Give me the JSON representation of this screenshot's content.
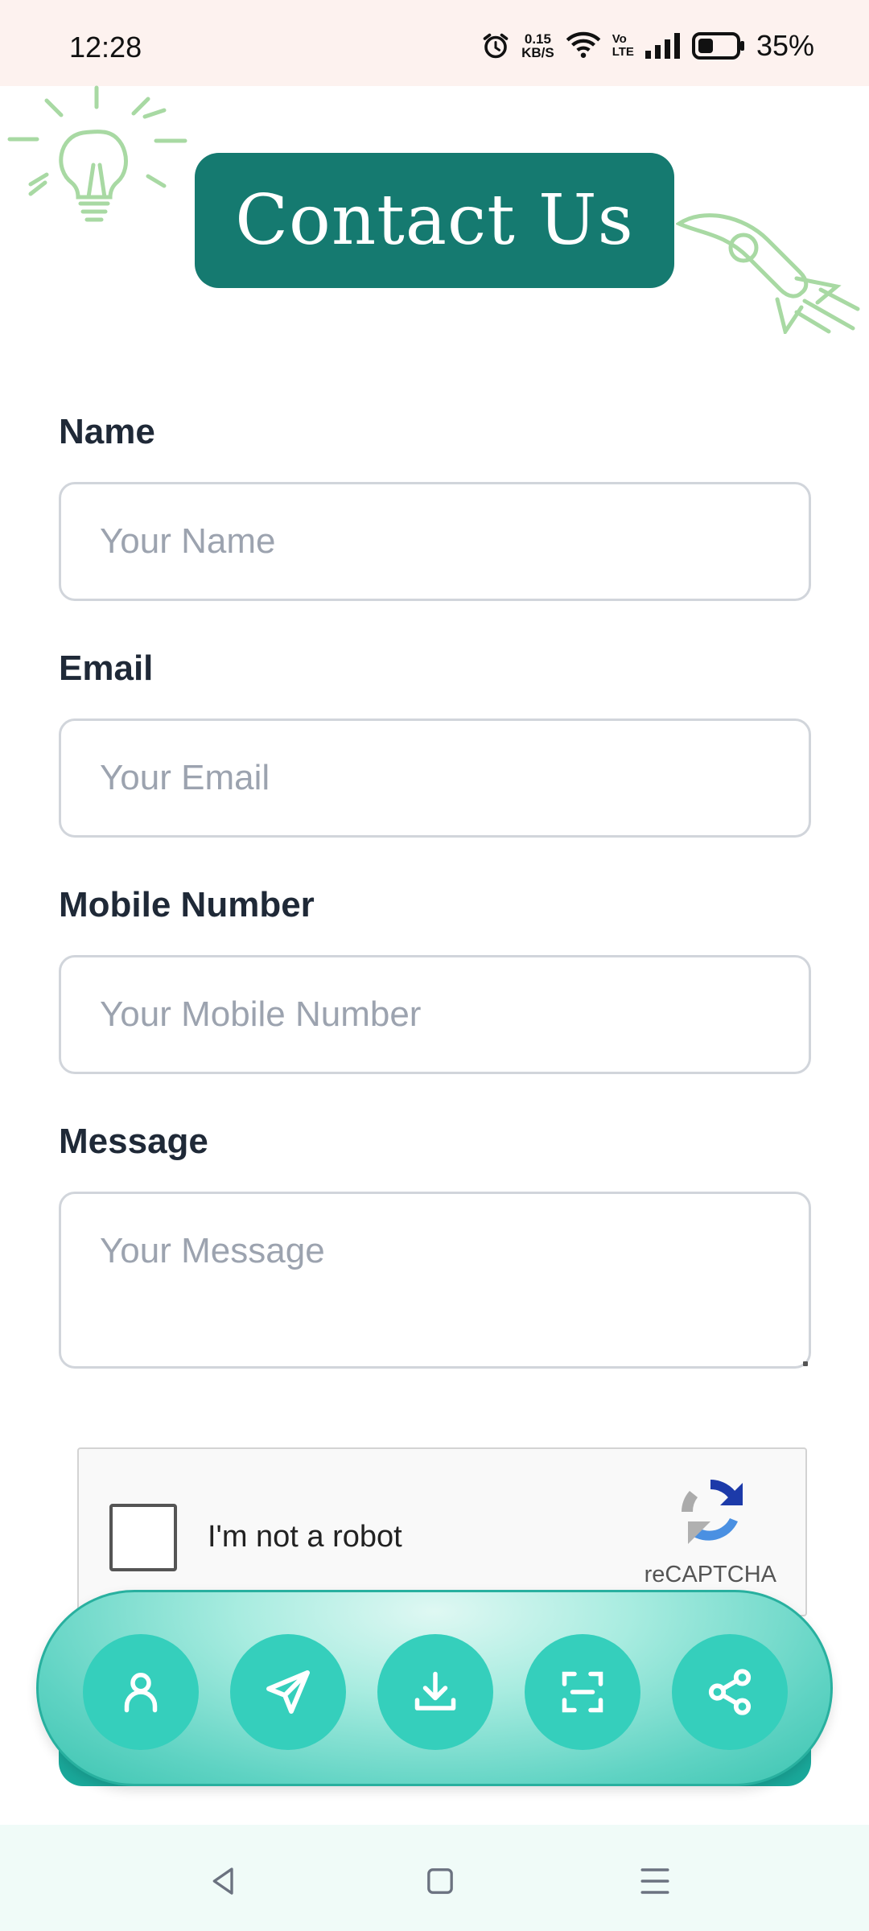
{
  "status_bar": {
    "time": "12:28",
    "net_speed_value": "0.15",
    "net_speed_unit": "KB/S",
    "volte_top": "Vo",
    "volte_bottom": "LTE",
    "battery": "35%"
  },
  "header": {
    "title": "Contact Us"
  },
  "form": {
    "name": {
      "label": "Name",
      "placeholder": "Your Name",
      "value": ""
    },
    "email": {
      "label": "Email",
      "placeholder": "Your Email",
      "value": ""
    },
    "mobile": {
      "label": "Mobile Number",
      "placeholder": "Your Mobile Number",
      "value": ""
    },
    "message": {
      "label": "Message",
      "placeholder": "Your Message",
      "value": ""
    }
  },
  "recaptcha": {
    "label": "I'm not a robot",
    "brand": "reCAPTCHA",
    "checked": false
  },
  "dock": {
    "buttons": [
      {
        "icon": "person-icon"
      },
      {
        "icon": "send-icon"
      },
      {
        "icon": "download-icon"
      },
      {
        "icon": "scan-icon"
      },
      {
        "icon": "share-icon"
      }
    ]
  },
  "nav": {
    "buttons": [
      "back-icon",
      "home-icon",
      "menu-icon"
    ]
  },
  "colors": {
    "accent": "#157a70",
    "dock_button": "#35cfbc",
    "status_bar_bg": "#fdf2ef"
  }
}
